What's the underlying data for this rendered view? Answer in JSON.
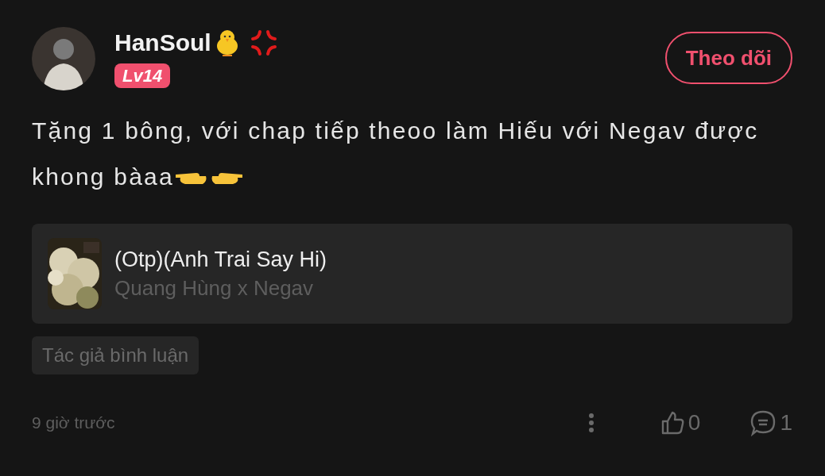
{
  "user": {
    "name": "HanSoul",
    "level_badge": "Lv14"
  },
  "follow_button": {
    "label": "Theo dõi",
    "following": false
  },
  "comment": {
    "text": "Tặng 1 bông, với chap tiếp theoo làm Hiếu với Negav được khong bàaa"
  },
  "story": {
    "title": "(Otp)(Anh Trai Say Hi)",
    "subtitle": "Quang Hùng x Negav"
  },
  "tag": "Tác giả bình luận",
  "footer": {
    "time": "9 giờ trước",
    "likes": "0",
    "replies": "1",
    "liked": false
  }
}
